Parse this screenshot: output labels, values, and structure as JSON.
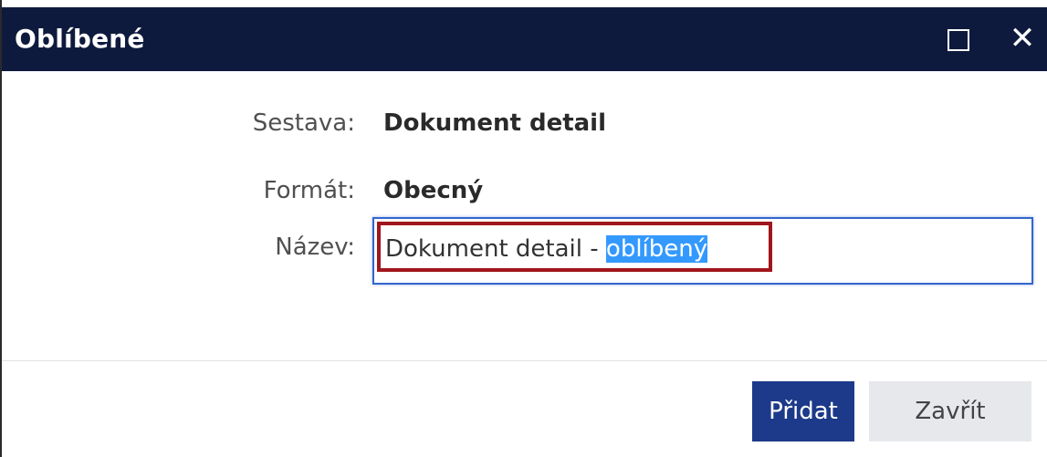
{
  "dialog": {
    "title": "Oblíbené",
    "maximize_icon": "maximize-icon",
    "close_icon": "close-icon",
    "close_glyph": "✕"
  },
  "form": {
    "report_label": "Sestava:",
    "report_value": "Dokument detail",
    "format_label": "Formát:",
    "format_value": "Obecný",
    "name_label": "Název:",
    "name_value_prefix": "Dokument detail - ",
    "name_value_selected": "oblíbený"
  },
  "buttons": {
    "add_label": "Přidat",
    "close_label": "Zavřít"
  },
  "colors": {
    "titlebar": "#0e1a3d",
    "primary_button": "#1d3a8a",
    "secondary_button": "#e6e8ec",
    "input_focus_border": "#3366cc",
    "text_selection": "#3399ff",
    "highlight_annotation": "#a0161c"
  }
}
